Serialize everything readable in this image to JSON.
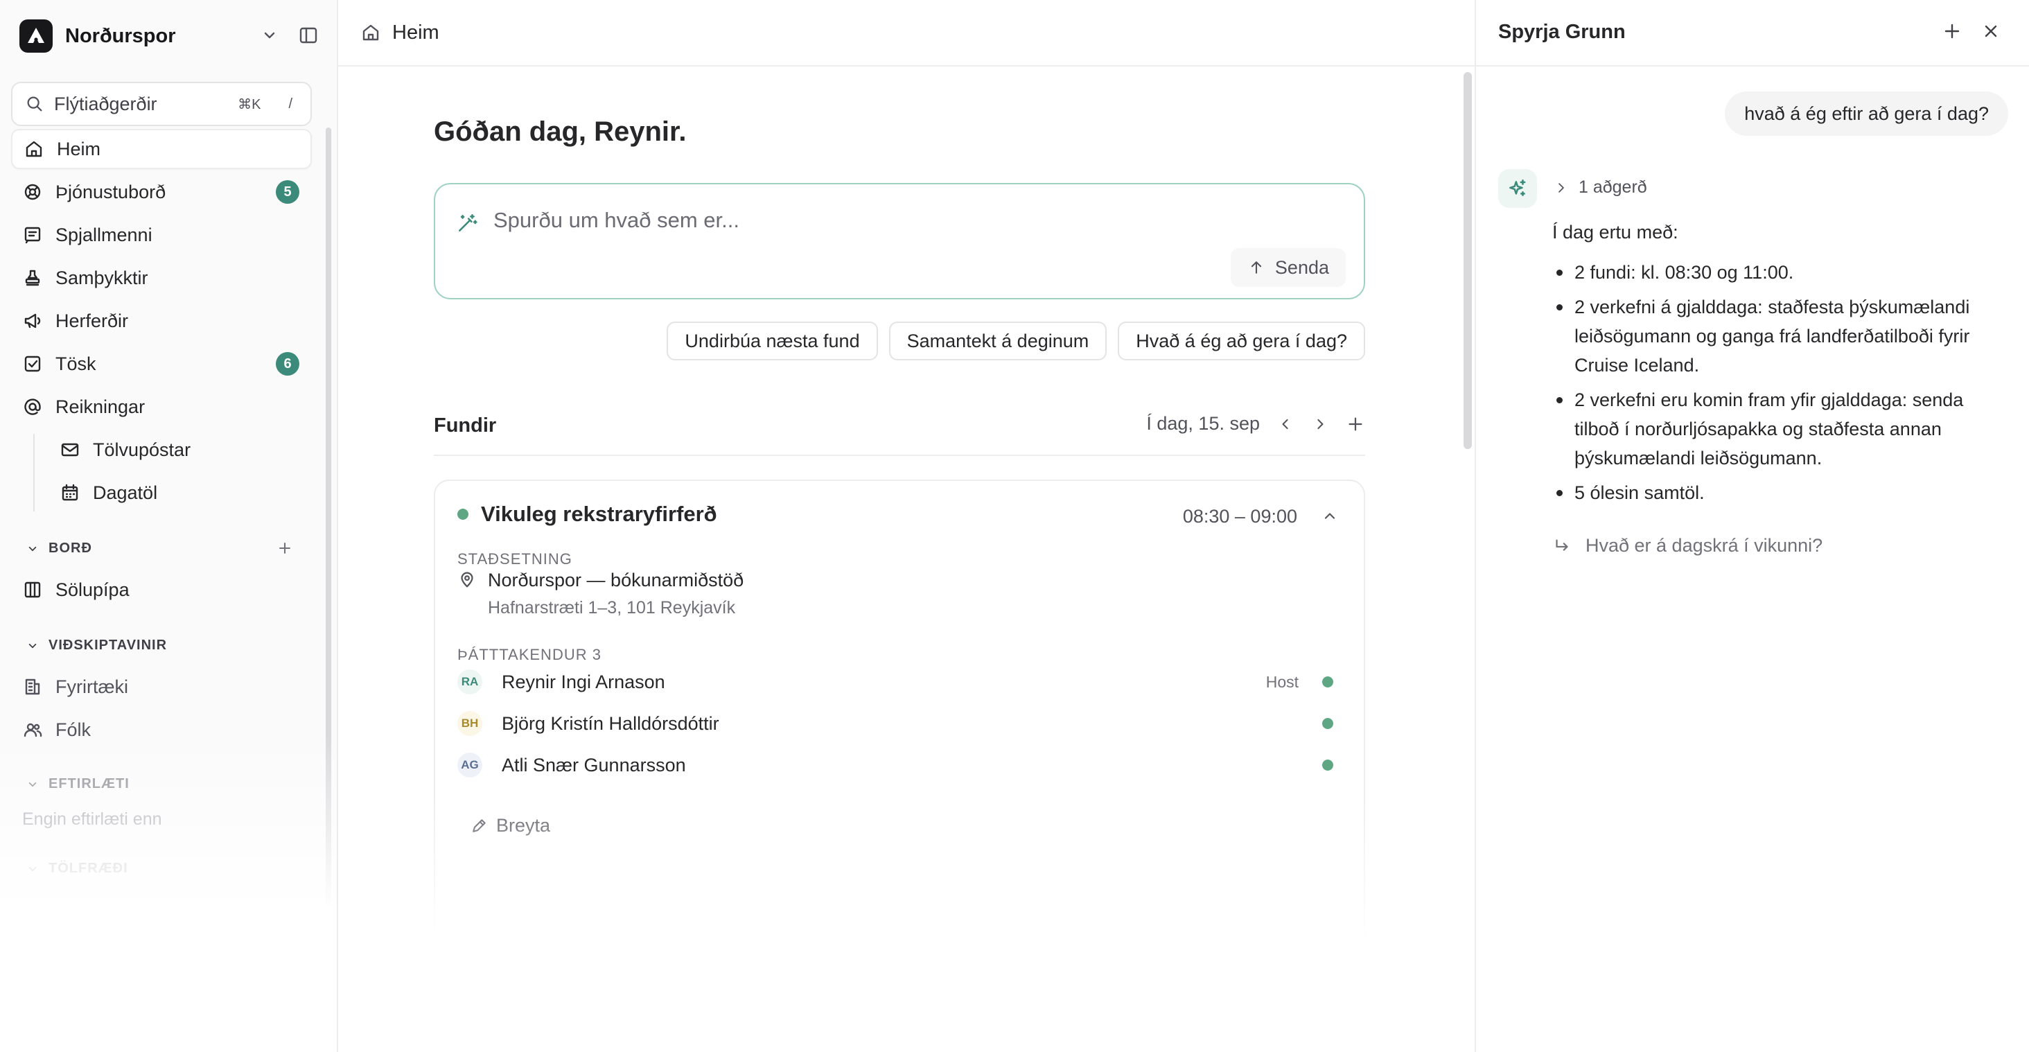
{
  "sidebar": {
    "brand": "Norðurspor",
    "search": {
      "label": "Flýtiaðgerðir",
      "shortcut": "⌘K",
      "slash": "/"
    },
    "nav": [
      {
        "label": "Heim",
        "icon": "home-icon",
        "active": true
      },
      {
        "label": "Þjónustuborð",
        "icon": "lifebuoy-icon",
        "badge": "5"
      },
      {
        "label": "Spjallmenni",
        "icon": "chat-lines-icon"
      },
      {
        "label": "Samþykktir",
        "icon": "stamp-icon"
      },
      {
        "label": "Herferðir",
        "icon": "megaphone-icon"
      },
      {
        "label": "Tösk",
        "icon": "checkbox-icon",
        "badge": "6"
      },
      {
        "label": "Reikningar",
        "icon": "at-sign-icon"
      }
    ],
    "subnav": [
      {
        "label": "Tölvupóstar",
        "icon": "mail-icon"
      },
      {
        "label": "Dagatöl",
        "icon": "calendar-icon"
      }
    ],
    "sections": {
      "bord": {
        "title": "BORÐ",
        "items": [
          {
            "label": "Sölupípa",
            "icon": "columns-icon"
          }
        ]
      },
      "vidskiptavinir": {
        "title": "VIÐSKIPTAVINIR",
        "items": [
          {
            "label": "Fyrirtæki",
            "icon": "building-icon"
          },
          {
            "label": "Fólk",
            "icon": "people-icon"
          }
        ]
      },
      "eftirlaeti": {
        "title": "EFTIRLÆTI",
        "empty": "Engin eftirlæti enn"
      },
      "tolfraedi": {
        "title": "TÖLFRÆÐI"
      }
    }
  },
  "main": {
    "breadcrumb": "Heim",
    "greeting": "Góðan dag, Reynir.",
    "prompt": {
      "placeholder": "Spurðu um hvað sem er...",
      "send": "Senda"
    },
    "chips": [
      "Undirbúa næsta fund",
      "Samantekt á deginum",
      "Hvað á ég að gera í dag?"
    ],
    "meetings": {
      "title": "Fundir",
      "date": "Í dag, 15. sep",
      "card": {
        "title": "Vikuleg rekstraryfirferð",
        "time": "08:30 – 09:00",
        "location_label": "STAÐSETNING",
        "location_name": "Norðurspor — bókunarmiðstöð",
        "location_address": "Hafnarstræti 1–3, 101 Reykjavík",
        "attendees_label": "ÞÁTTTAKENDUR 3",
        "attendees": [
          {
            "initials": "RA",
            "name": "Reynir Ingi Arnason",
            "role": "Host"
          },
          {
            "initials": "BH",
            "name": "Björg Kristín Halldórsdóttir",
            "role": ""
          },
          {
            "initials": "AG",
            "name": "Atli Snær Gunnarsson",
            "role": ""
          }
        ],
        "edit": "Breyta"
      }
    }
  },
  "assistant": {
    "title": "Spyrja Grunn",
    "user_message": "hvað á ég eftir að gera í dag?",
    "action": "1 aðgerð",
    "intro": "Í dag ertu með:",
    "bullets": [
      "2 fundi: kl. 08:30 og 11:00.",
      "2 verkefni á gjalddaga: staðfesta þýskumælandi leiðsögumann og ganga frá landferðatilboði fyrir Cruise Iceland.",
      "2 verkefni eru komin fram yfir gjalddaga: senda tilboð í norðurljósapakka og staðfesta annan þýskumælandi leiðsögumann.",
      "5 ólesin samtöl."
    ],
    "followup": "Hvað er á dagskrá í vikunni?"
  },
  "colors": {
    "accent": "#3c8b7a",
    "accent_light": "#9fd3c1",
    "status_green": "#5fa784",
    "text": "#27272a",
    "muted": "#71717a"
  }
}
